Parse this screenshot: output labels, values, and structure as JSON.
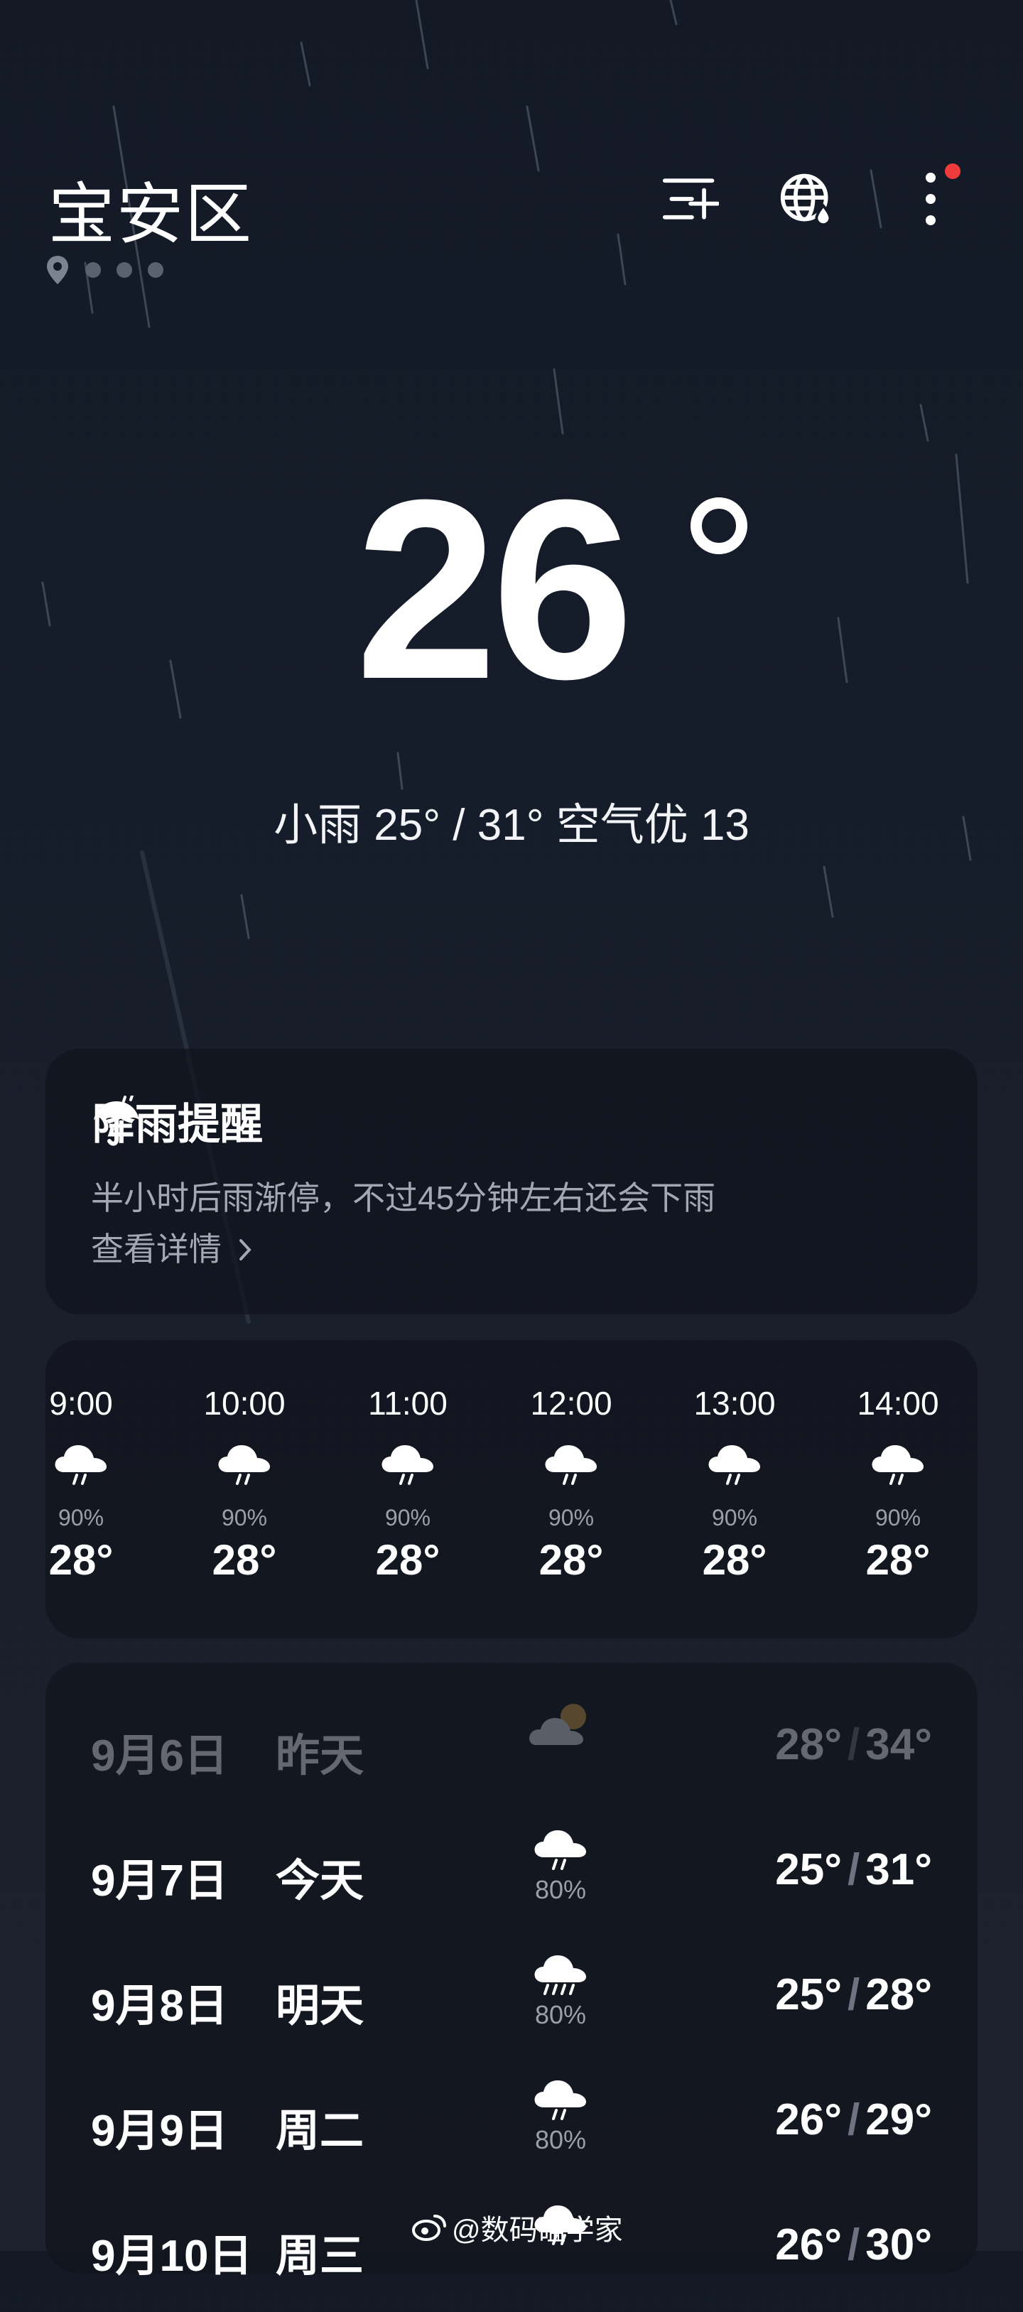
{
  "header": {
    "city": "宝安区"
  },
  "current": {
    "temperature": "26",
    "summary": "小雨  25° / 31°  空气优 13"
  },
  "rain_alert": {
    "title": "降雨提醒",
    "description": "半小时后雨渐停，不过45分钟左右还会下雨",
    "link": "查看详情"
  },
  "hourly": [
    {
      "time": "9:00",
      "pop": "90%",
      "temp": "28°",
      "icon": "rain-cloud-icon"
    },
    {
      "time": "10:00",
      "pop": "90%",
      "temp": "28°",
      "icon": "rain-cloud-icon"
    },
    {
      "time": "11:00",
      "pop": "90%",
      "temp": "28°",
      "icon": "rain-cloud-icon"
    },
    {
      "time": "12:00",
      "pop": "90%",
      "temp": "28°",
      "icon": "rain-cloud-icon"
    },
    {
      "time": "13:00",
      "pop": "90%",
      "temp": "28°",
      "icon": "rain-cloud-icon"
    },
    {
      "time": "14:00",
      "pop": "90%",
      "temp": "28°",
      "icon": "rain-cloud-icon"
    }
  ],
  "daily": [
    {
      "date": "9月6日",
      "label": "昨天",
      "pop": "",
      "low": "28°",
      "high": "34°",
      "icon": "partly-cloudy-icon"
    },
    {
      "date": "9月7日",
      "label": "今天",
      "pop": "80%",
      "low": "25°",
      "high": "31°",
      "icon": "rain-cloud-icon"
    },
    {
      "date": "9月8日",
      "label": "明天",
      "pop": "80%",
      "low": "25°",
      "high": "28°",
      "icon": "heavy-rain-icon"
    },
    {
      "date": "9月9日",
      "label": "周二",
      "pop": "80%",
      "low": "26°",
      "high": "29°",
      "icon": "rain-cloud-icon"
    },
    {
      "date": "9月10日",
      "label": "周三",
      "pop": "",
      "low": "26°",
      "high": "30°",
      "icon": "rain-cloud-icon"
    }
  ],
  "watermark": "@数码磕学家",
  "colors": {
    "background": "#151c28",
    "card": "#10141c",
    "badge": "#ef3b3b",
    "muted_text": "#a3a8b2"
  }
}
